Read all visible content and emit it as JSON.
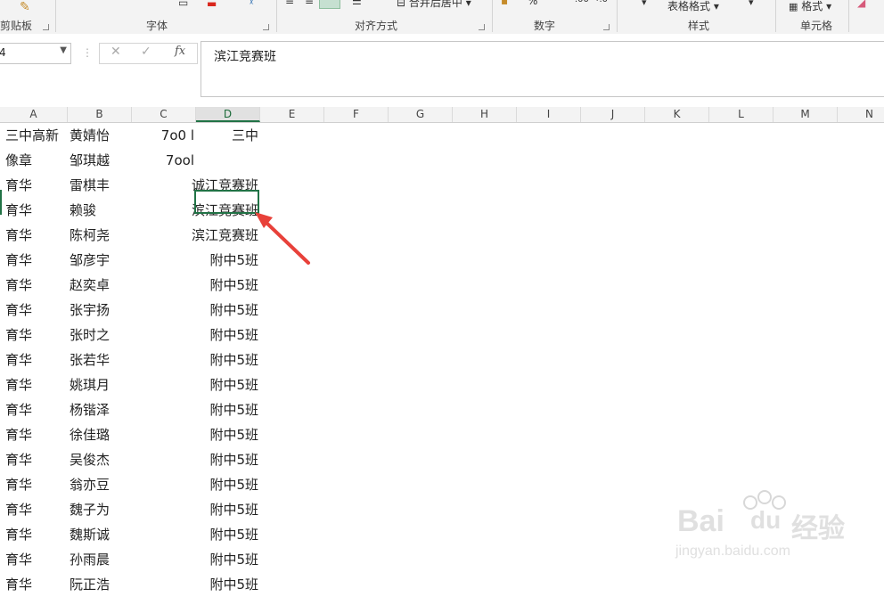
{
  "ribbon": {
    "groups": {
      "clipboard": "剪贴板",
      "font": "字体",
      "alignment": "对齐方式",
      "number": "数字",
      "styles": "样式",
      "cells": "单元格"
    },
    "merge_label": "合并后居中",
    "table_format_label": "表格格式",
    "format_label": "格式",
    "percent_label": "%"
  },
  "formula_bar": {
    "name_box_value": "4",
    "fx_label": "fx",
    "content": "滨江竞赛班"
  },
  "columns": [
    "A",
    "B",
    "C",
    "D",
    "E",
    "F",
    "G",
    "H",
    "I",
    "J",
    "K",
    "L",
    "M",
    "N"
  ],
  "selected_column": "D",
  "rows": [
    {
      "a": "三中高新",
      "b": "黄婧怡",
      "c": "7o0 l",
      "d": "三中"
    },
    {
      "a": "像章",
      "b": "邹琪越",
      "c": "7ool",
      "d": ""
    },
    {
      "a": "育华",
      "b": "雷棋丰",
      "c": "",
      "d": "诚江竞赛班"
    },
    {
      "a": "育华",
      "b": "赖骏",
      "c": "",
      "d": "滨江竞赛班"
    },
    {
      "a": "育华",
      "b": "陈柯尧",
      "c": "",
      "d": "滨江竞赛班"
    },
    {
      "a": "育华",
      "b": "邹彦宇",
      "c": "",
      "d": "附中5班"
    },
    {
      "a": "育华",
      "b": "赵奕卓",
      "c": "",
      "d": "附中5班"
    },
    {
      "a": "育华",
      "b": "张宇扬",
      "c": "",
      "d": "附中5班"
    },
    {
      "a": "育华",
      "b": "张时之",
      "c": "",
      "d": "附中5班"
    },
    {
      "a": "育华",
      "b": "张若华",
      "c": "",
      "d": "附中5班"
    },
    {
      "a": "育华",
      "b": "姚琪月",
      "c": "",
      "d": "附中5班"
    },
    {
      "a": "育华",
      "b": "杨锴泽",
      "c": "",
      "d": "附中5班"
    },
    {
      "a": "育华",
      "b": "徐佳璐",
      "c": "",
      "d": "附中5班"
    },
    {
      "a": "育华",
      "b": "吴俊杰",
      "c": "",
      "d": "附中5班"
    },
    {
      "a": "育华",
      "b": "翁亦豆",
      "c": "",
      "d": "附中5班"
    },
    {
      "a": "育华",
      "b": "魏子为",
      "c": "",
      "d": "附中5班"
    },
    {
      "a": "育华",
      "b": "魏斯诚",
      "c": "",
      "d": "附中5班"
    },
    {
      "a": "育华",
      "b": "孙雨晨",
      "c": "",
      "d": "附中5班"
    },
    {
      "a": "育华",
      "b": "阮正浩",
      "c": "",
      "d": "附中5班"
    }
  ],
  "watermark": {
    "brand": "Bai",
    "brand2": "du",
    "product": "经验",
    "url": "jingyan.baidu.com"
  },
  "colors": {
    "accent": "#217346",
    "arrow": "#e8413a"
  }
}
